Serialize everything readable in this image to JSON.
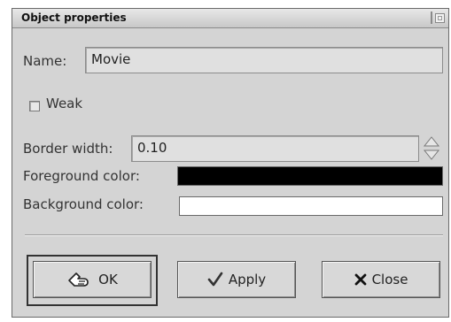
{
  "window": {
    "title": "Object properties"
  },
  "form": {
    "name_label": "Name:",
    "name_value": "Movie",
    "weak_label": "Weak",
    "weak_checked": false,
    "border_width_label": "Border width:",
    "border_width_value": "0.10",
    "foreground_label": "Foreground color:",
    "foreground_color": "#000000",
    "background_label": "Background color:",
    "background_color": "#ffffff"
  },
  "buttons": {
    "ok_label": "OK",
    "ok_icon": "hand-pointer-icon",
    "apply_label": "Apply",
    "apply_icon": "checkmark-icon",
    "close_label": "Close",
    "close_icon": "x-close-icon"
  }
}
